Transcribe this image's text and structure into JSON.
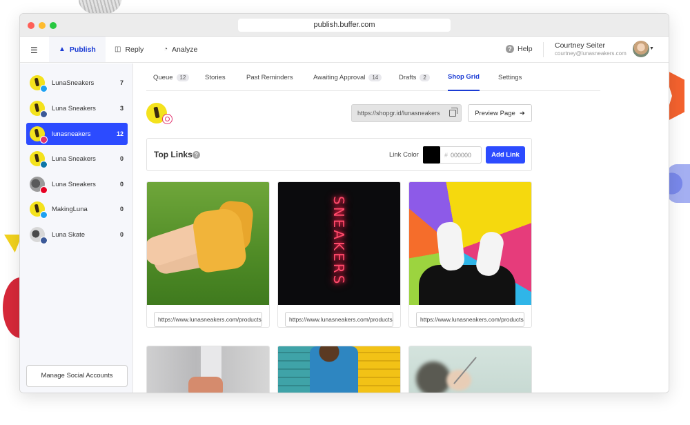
{
  "browser": {
    "url": "publish.buffer.com"
  },
  "nav": {
    "tabs": [
      {
        "label": "Publish",
        "icon": "layers-icon"
      },
      {
        "label": "Reply",
        "icon": "reply-icon"
      },
      {
        "label": "Analyze",
        "icon": "chart-icon"
      }
    ],
    "help_label": "Help",
    "user_name": "Courtney Seiter",
    "user_email": "courtney@lunasneakers.com"
  },
  "sidebar": {
    "accounts": [
      {
        "name": "LunaSneakers",
        "count": "7",
        "network": "twitter"
      },
      {
        "name": "Luna Sneakers",
        "count": "3",
        "network": "facebook"
      },
      {
        "name": "lunasneakers",
        "count": "12",
        "network": "instagram"
      },
      {
        "name": "Luna Sneakers",
        "count": "0",
        "network": "linkedin"
      },
      {
        "name": "Luna Sneakers",
        "count": "0",
        "network": "pinterest"
      },
      {
        "name": "MakingLuna",
        "count": "0",
        "network": "twitter"
      },
      {
        "name": "Luna Skate",
        "count": "0",
        "network": "facebook"
      }
    ],
    "manage_label": "Manage Social Accounts"
  },
  "main": {
    "tabs": [
      {
        "label": "Queue",
        "count": "12"
      },
      {
        "label": "Stories",
        "count": ""
      },
      {
        "label": "Past Reminders",
        "count": ""
      },
      {
        "label": "Awaiting Approval",
        "count": "14"
      },
      {
        "label": "Drafts",
        "count": "2"
      },
      {
        "label": "Shop Grid",
        "count": ""
      },
      {
        "label": "Settings",
        "count": ""
      }
    ],
    "shop_url": "https://shopgr.id/lunasneakers",
    "preview_label": "Preview Page",
    "top_links": {
      "title": "Top Links",
      "color_label": "Link Color",
      "color_value": "#000000",
      "hex_placeholder": "000000",
      "hash": "#",
      "add_label": "Add Link"
    },
    "grid": [
      {
        "link": "https://www.lunasneakers.com/products"
      },
      {
        "link": "https://www.lunasneakers.com/products",
        "neon": "SNEAKERS"
      },
      {
        "link": "https://www.lunasneakers.com/products"
      }
    ]
  },
  "colors": {
    "accent": "#2c4bff",
    "active_nav": "#1a3bd4",
    "sidebar_bg": "#f6f7fb"
  }
}
